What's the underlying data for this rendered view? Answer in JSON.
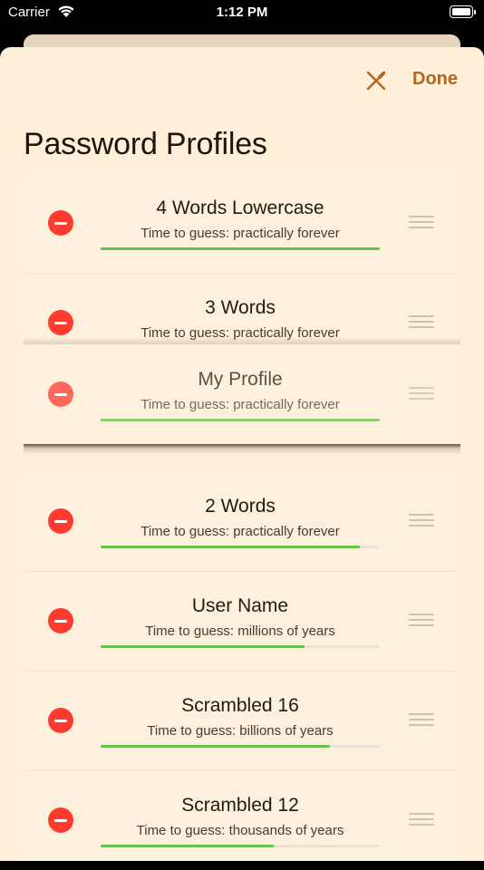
{
  "status_bar": {
    "carrier": "Carrier",
    "time": "1:12 PM"
  },
  "header": {
    "done_label": "Done",
    "tools_icon": "pen-cross-icon"
  },
  "page_title": "Password Profiles",
  "profiles": [
    {
      "name": "4 Words Lowercase",
      "time_to_guess": "Time to guess: practically forever",
      "strength": 1.0
    },
    {
      "name": "3 Words",
      "time_to_guess": "Time to guess: practically forever",
      "strength": 1.0
    },
    {
      "name": "My Profile",
      "time_to_guess": "Time to guess: practically forever",
      "strength": 1.0,
      "dragging": true
    },
    {
      "name": "2 Words",
      "time_to_guess": "Time to guess: practically forever",
      "strength": 0.93
    },
    {
      "name": "User Name",
      "time_to_guess": "Time to guess: millions of years",
      "strength": 0.73
    },
    {
      "name": "Scrambled 16",
      "time_to_guess": "Time to guess: billions of years",
      "strength": 0.82
    },
    {
      "name": "Scrambled 12",
      "time_to_guess": "Time to guess: thousands of years",
      "strength": 0.62
    }
  ],
  "colors": {
    "accent": "#b5651d",
    "delete": "#ff3b30",
    "strength_bar": "#68c24a",
    "sheet_background": "#fdefd8"
  }
}
